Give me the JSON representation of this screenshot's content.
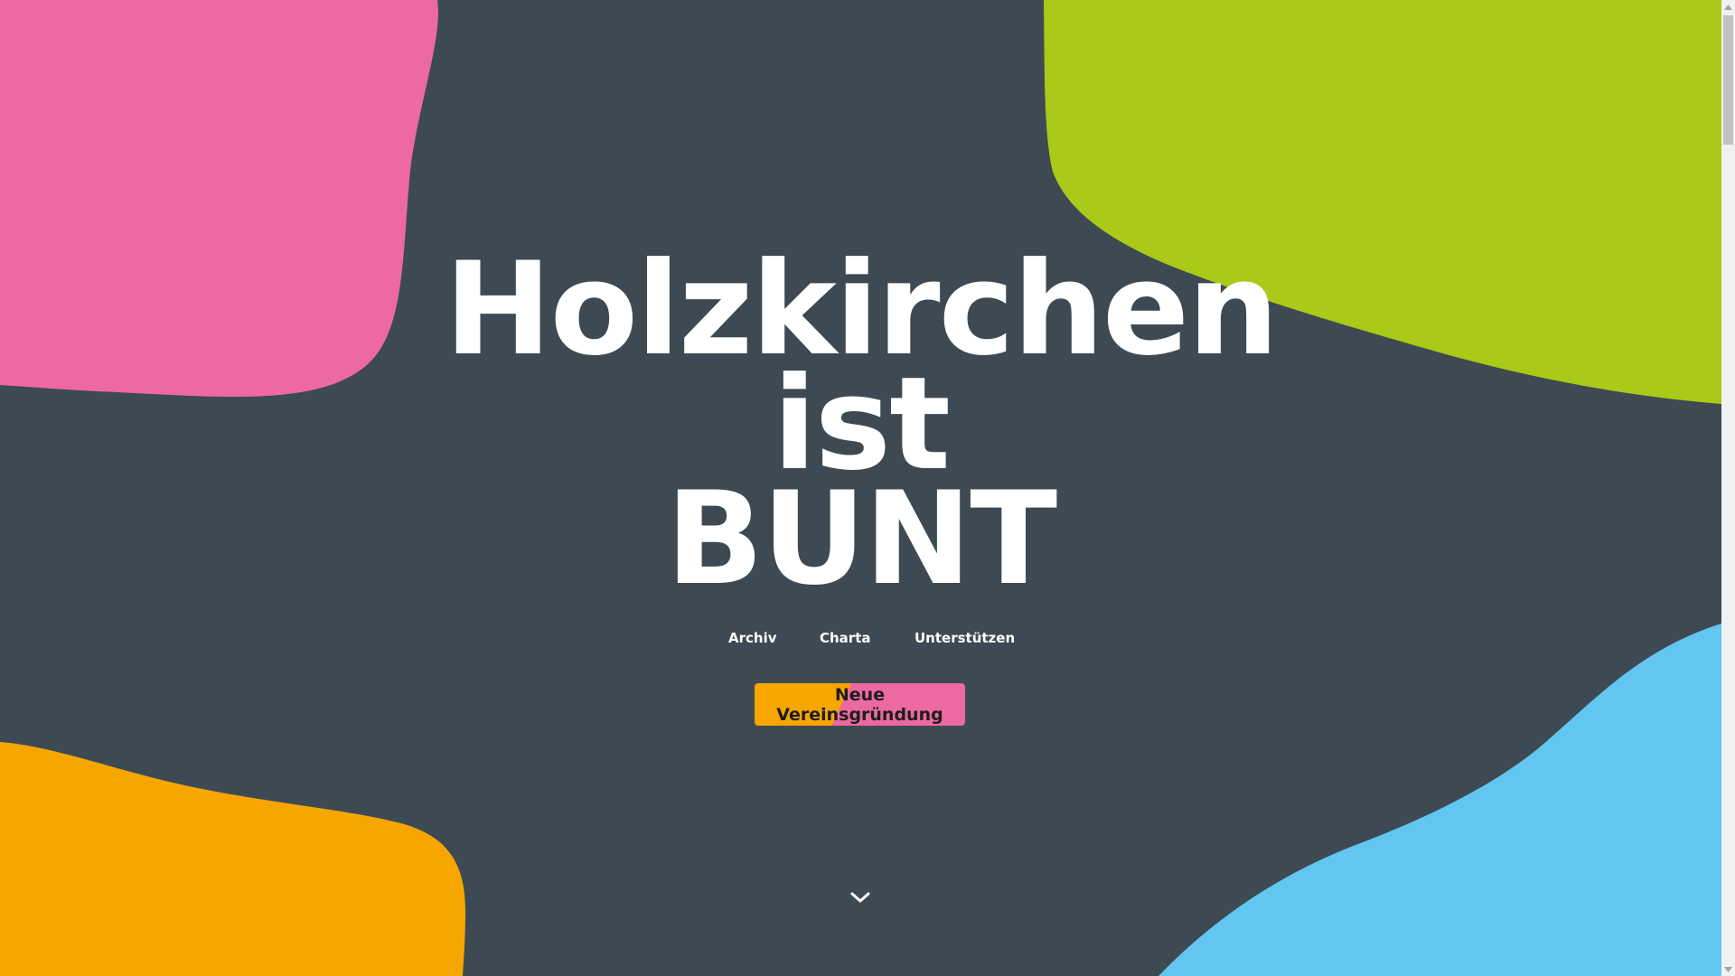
{
  "hero": {
    "title_line1": "Holzkirchen",
    "title_line2": "ist",
    "title_line3": "BUNT"
  },
  "nav": {
    "items": [
      {
        "label": "Archiv"
      },
      {
        "label": "Charta"
      },
      {
        "label": "Unterstützen"
      }
    ]
  },
  "cta": {
    "label": "Neue Vereinsgründung"
  },
  "icons": {
    "scroll_down": "chevron-down-icon",
    "scroll_up_arrow": "scroll-up-arrow-icon",
    "scroll_down_arrow": "scroll-down-arrow-icon"
  },
  "colors": {
    "background": "#3d4a53",
    "pink": "#ec69a1",
    "green": "#aac918",
    "orange": "#f7a600",
    "blue": "#62c6f1",
    "text": "#ffffff"
  }
}
